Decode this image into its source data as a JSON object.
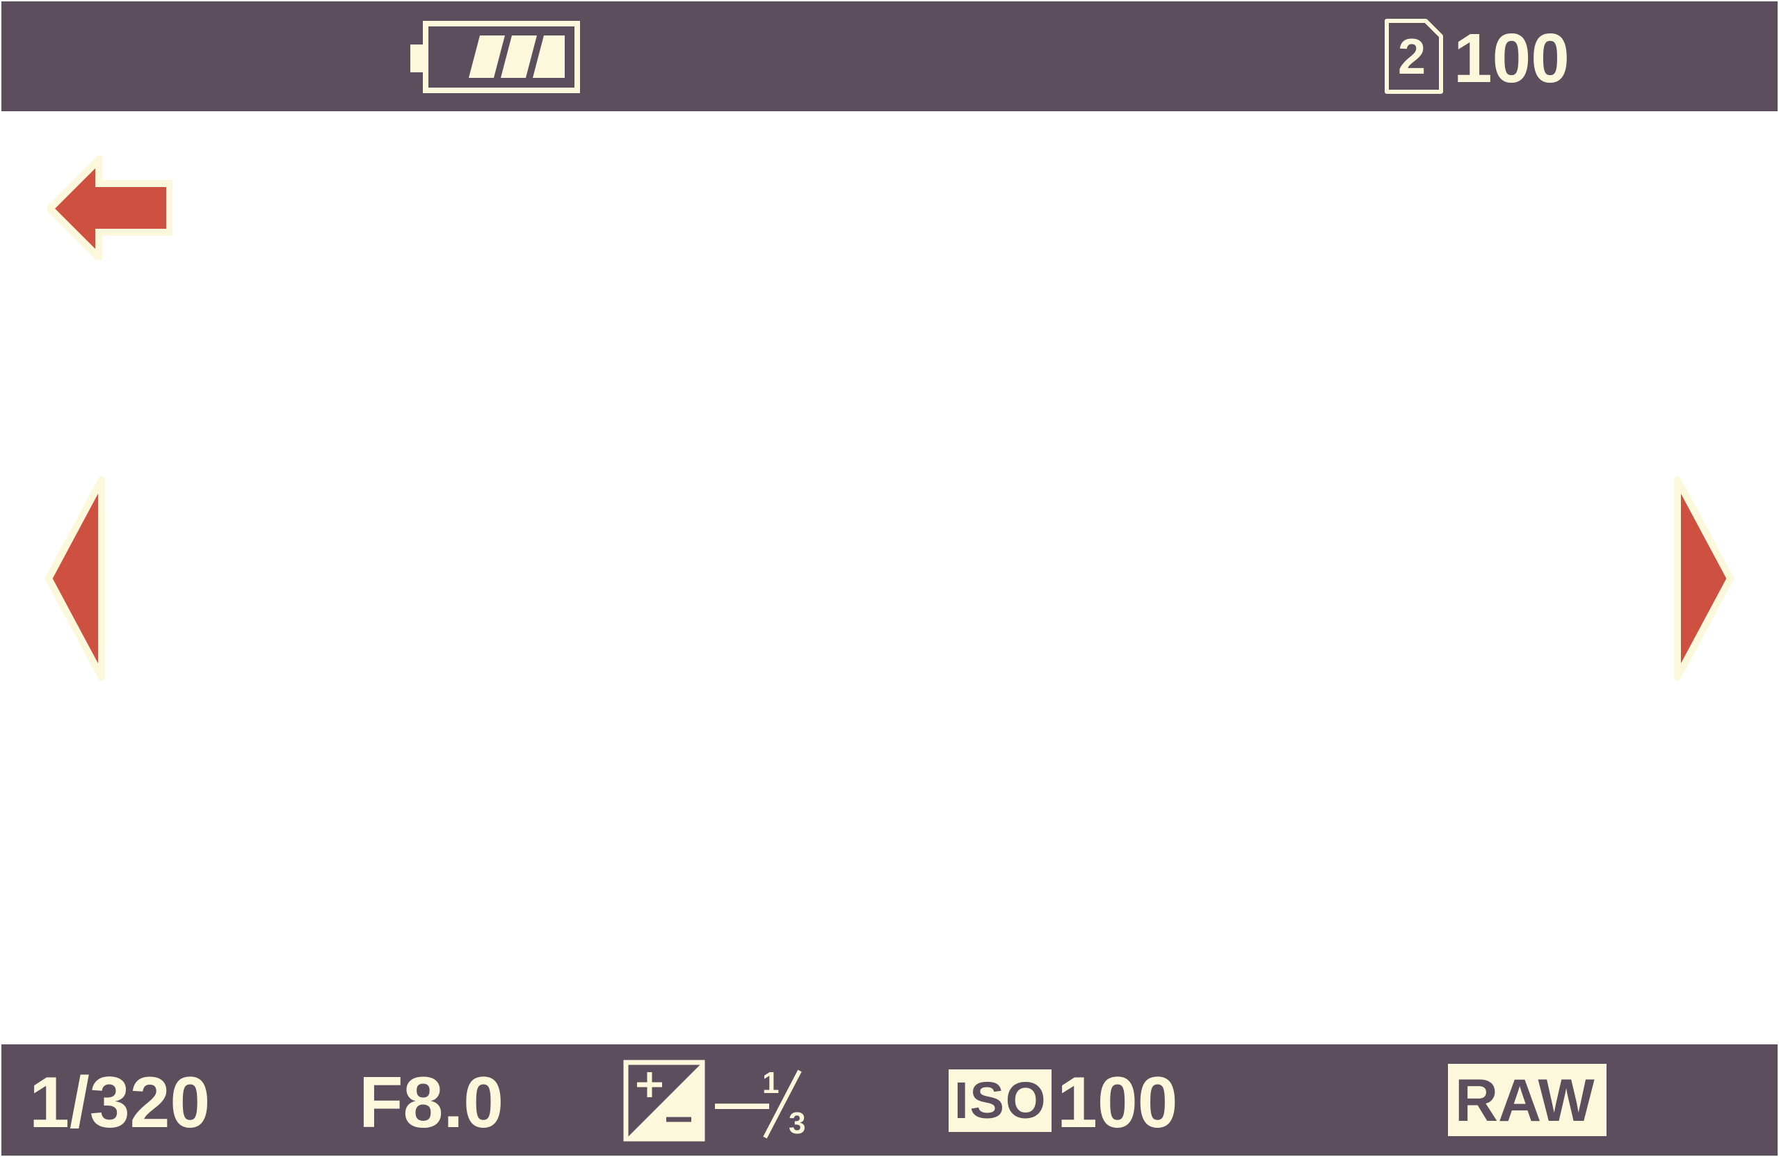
{
  "colors": {
    "bar_background": "#5c4e5c",
    "overlay_text": "#fbf8dc",
    "arrow_fill": "#cd5040",
    "arrow_outline": "#fbf8dc",
    "viewport_background": "#ffffff"
  },
  "top_bar": {
    "battery": {
      "icon": "battery-icon",
      "level": "3 of 3 bars"
    },
    "memory_card": {
      "icon": "memory-card-icon",
      "slot": "2",
      "remaining_shots": "100"
    }
  },
  "navigation": {
    "back": {
      "icon": "back-arrow-icon"
    },
    "previous": {
      "icon": "triangle-left-icon"
    },
    "next": {
      "icon": "triangle-right-icon"
    }
  },
  "bottom_bar": {
    "shutter_speed": "1/320",
    "aperture": "F8.0",
    "exposure_compensation": {
      "icon": "exposure-compensation-icon",
      "sign": "—",
      "numerator": "1",
      "denominator": "3"
    },
    "iso": {
      "badge": "ISO",
      "value": "100"
    },
    "file_format": "RAW"
  }
}
